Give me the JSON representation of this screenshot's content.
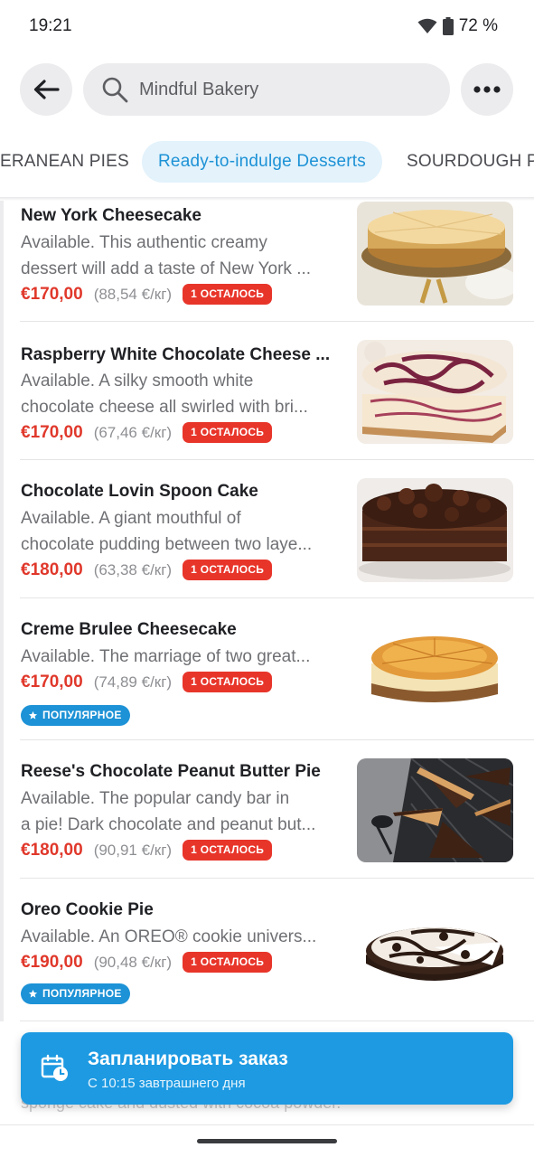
{
  "status": {
    "time": "19:21",
    "battery": "72 %"
  },
  "search": {
    "text": "Mindful Bakery",
    "icon": "search-icon"
  },
  "tabs": [
    {
      "label": "ERANEAN PIES",
      "active": false
    },
    {
      "label": "Ready-to-indulge Desserts",
      "active": true
    },
    {
      "label": "SOURDOUGH P",
      "active": false
    }
  ],
  "items": [
    {
      "title": "New York Cheesecake",
      "desc": [
        "Available. This authentic creamy",
        "dessert will add a taste of New York ..."
      ],
      "price": "€170,00",
      "unit": "(88,54 €/кг)",
      "badge": "1 ОСТАЛОСЬ"
    },
    {
      "title": "Raspberry White Chocolate Cheese ...",
      "desc": [
        "Available. A silky smooth white",
        "chocolate cheese all swirled with bri..."
      ],
      "price": "€170,00",
      "unit": "(67,46 €/кг)",
      "badge": "1 ОСТАЛОСЬ"
    },
    {
      "title": "Chocolate Lovin Spoon Cake",
      "desc": [
        "Available. A giant mouthful of",
        "chocolate pudding between two laye..."
      ],
      "price": "€180,00",
      "unit": "(63,38 €/кг)",
      "badge": "1 ОСТАЛОСЬ"
    },
    {
      "title": "Creme Brulee Cheesecake",
      "desc": [
        "Available. The marriage of two great..."
      ],
      "price": "€170,00",
      "unit": "(74,89 €/кг)",
      "badge": "1 ОСТАЛОСЬ",
      "popular": "ПОПУЛЯРНОЕ"
    },
    {
      "title": "Reese's Chocolate Peanut Butter Pie",
      "desc": [
        "Available. The popular candy bar in",
        "a pie! Dark chocolate and peanut but..."
      ],
      "price": "€180,00",
      "unit": "(90,91 €/кг)",
      "badge": "1 ОСТАЛОСЬ"
    },
    {
      "title": "Oreo Cookie Pie",
      "desc": [
        "Available. An OREO® cookie univers..."
      ],
      "price": "€190,00",
      "unit": "(90,48 €/кг)",
      "badge": "1 ОСТАЛОСЬ",
      "popular": "ПОПУЛЯРНОЕ"
    }
  ],
  "schedule": {
    "title": "Запланировать заказ",
    "subtitle": "С 10:15 завтрашнего дня"
  },
  "peek_text": "sponge cake and dusted with cocoa powder.",
  "colors": {
    "accent": "#1d92d6",
    "price": "#e0382b",
    "badge": "#e8352a",
    "tab_active_bg": "#e3f2fb"
  }
}
